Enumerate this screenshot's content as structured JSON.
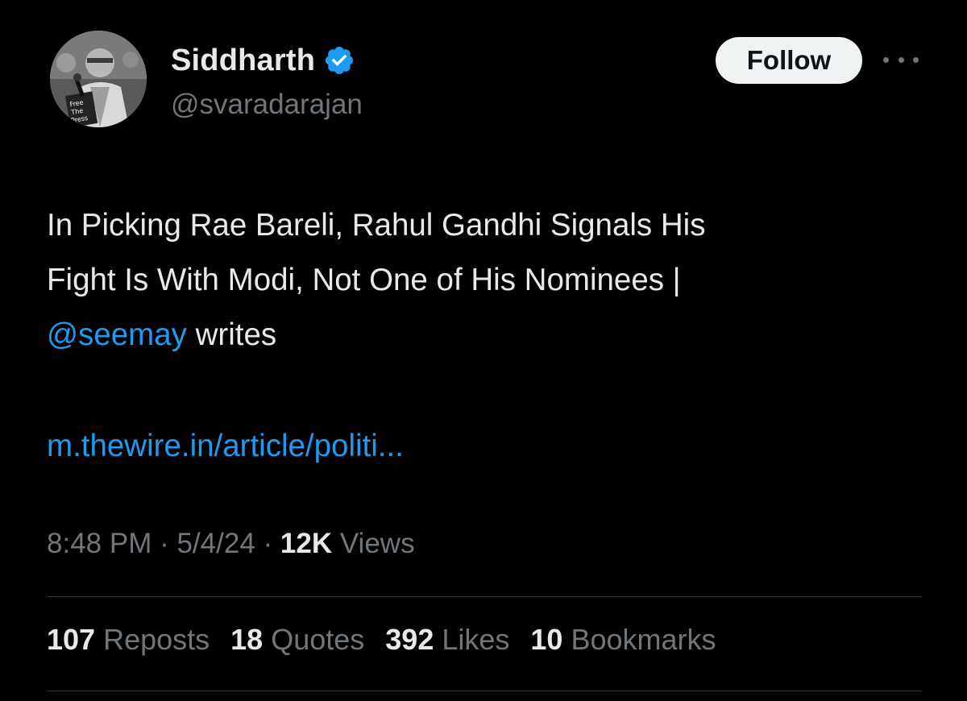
{
  "author": {
    "display_name": "Siddharth",
    "handle": "@svaradarajan",
    "verified": true,
    "avatar_sign_text": "Free The Press"
  },
  "actions": {
    "follow_label": "Follow"
  },
  "tweet": {
    "text_line_1": "In Picking Rae Bareli, Rahul Gandhi Signals His",
    "text_line_2": "Fight Is With Modi, Not One of His Nominees |",
    "mention": "@seemay",
    "mention_suffix": " writes",
    "link": "m.thewire.in/article/politi..."
  },
  "meta": {
    "time": "8:48 PM",
    "separator": " · ",
    "date": "5/4/24",
    "views_count": "12K",
    "views_label": " Views"
  },
  "stats": [
    {
      "count": "107",
      "label": "Reposts"
    },
    {
      "count": "18",
      "label": "Quotes"
    },
    {
      "count": "392",
      "label": "Likes"
    },
    {
      "count": "10",
      "label": "Bookmarks"
    }
  ],
  "colors": {
    "background": "#000000",
    "link": "#1d9bf0",
    "verified": "#1d9bf0",
    "secondary_text": "#71767b"
  }
}
